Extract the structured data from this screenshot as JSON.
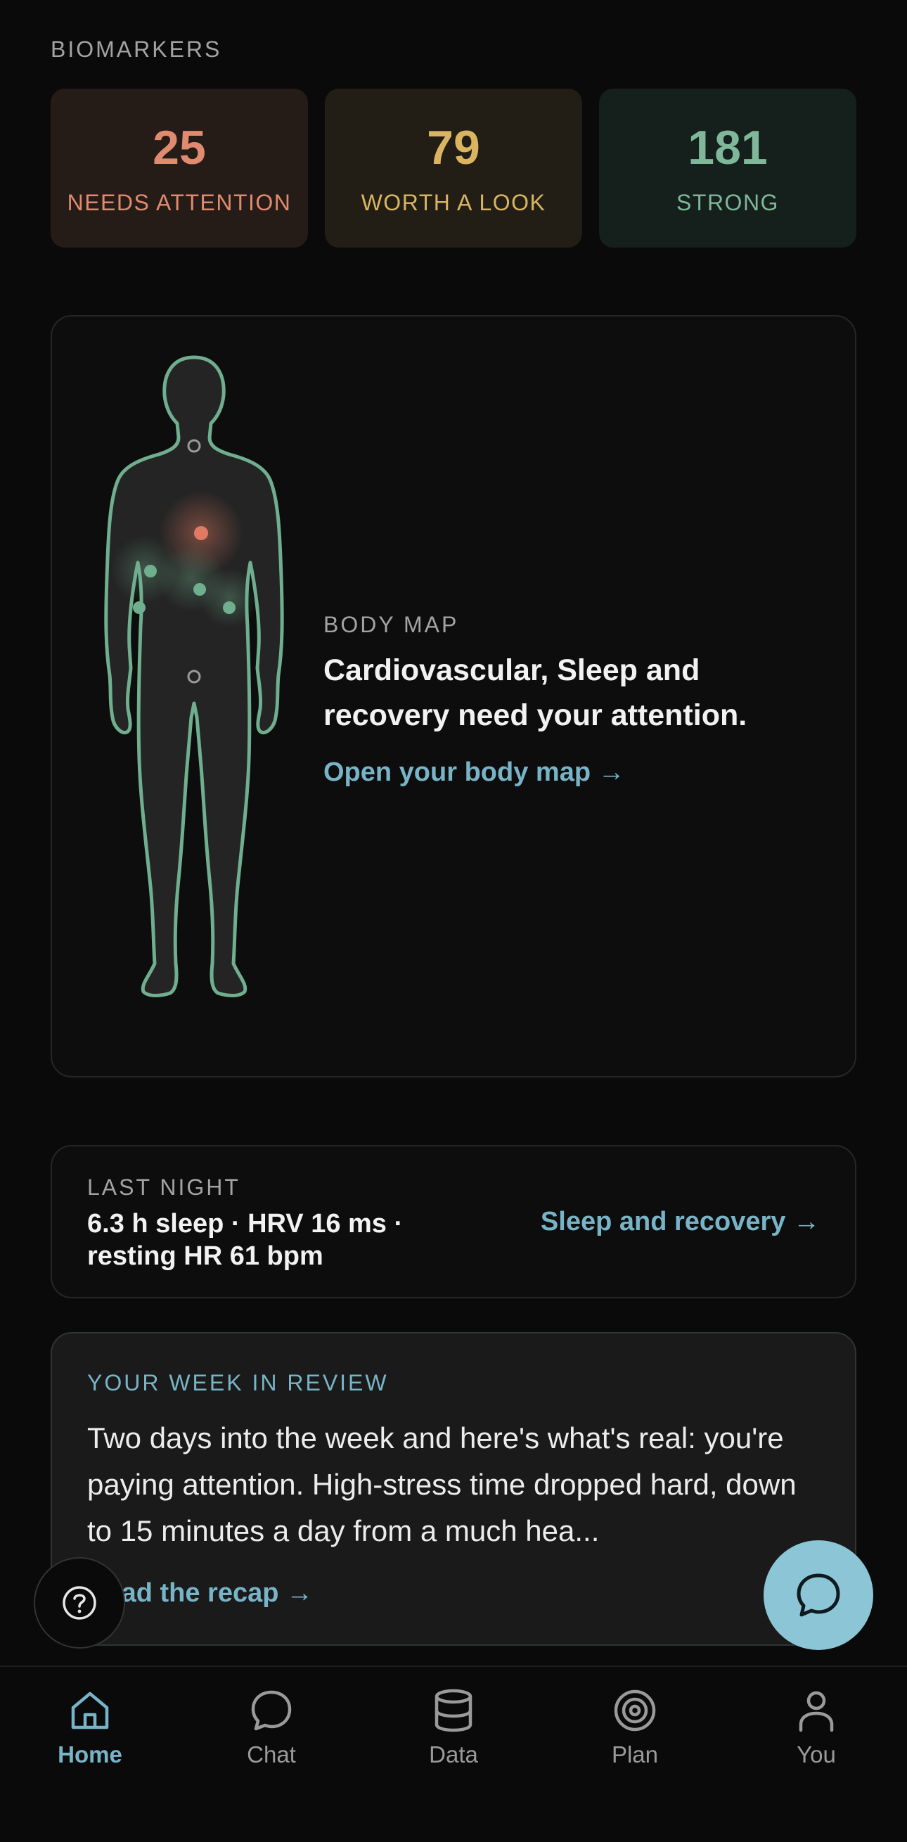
{
  "biomarkers": {
    "label": "BIOMARKERS",
    "tiles": [
      {
        "count": "25",
        "label": "NEEDS ATTENTION",
        "color": "#e08a6f"
      },
      {
        "count": "79",
        "label": "WORTH A LOOK",
        "color": "#d9b561"
      },
      {
        "count": "181",
        "label": "STRONG",
        "color": "#7fb79a"
      }
    ]
  },
  "body_map": {
    "eyebrow": "BODY MAP",
    "title": "Cardiovascular, Sleep and recovery need your attention.",
    "link": "Open your body map →"
  },
  "last_night": {
    "eyebrow": "LAST NIGHT",
    "summary": "6.3 h sleep · HRV 16 ms · resting HR 61 bpm",
    "link": "Sleep and recovery →"
  },
  "week_review": {
    "eyebrow": "YOUR WEEK IN REVIEW",
    "body": "Two days into the week and here's what's real: you're paying attention.  High-stress time dropped hard, down to 15 minutes a day from a much hea...",
    "link": "Read the recap →"
  },
  "fab": {
    "help_icon": "question-icon",
    "chat_icon": "chat-bubble-icon"
  },
  "tabs": [
    {
      "label": "Home",
      "icon": "home-icon",
      "active": true
    },
    {
      "label": "Chat",
      "icon": "chat-icon",
      "active": false
    },
    {
      "label": "Data",
      "icon": "database-icon",
      "active": false
    },
    {
      "label": "Plan",
      "icon": "target-icon",
      "active": false
    },
    {
      "label": "You",
      "icon": "person-icon",
      "active": false
    }
  ],
  "colors": {
    "accent": "#78b4c8",
    "outline": "#6fae8e",
    "alert": "#e07a62"
  }
}
